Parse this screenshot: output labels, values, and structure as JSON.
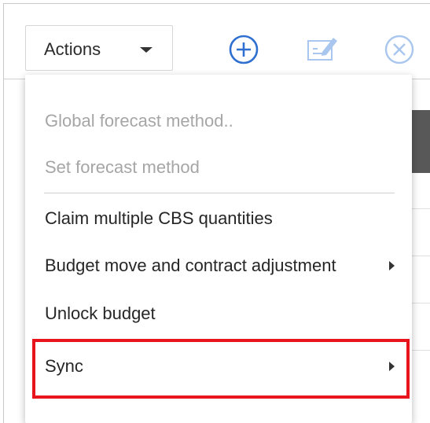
{
  "toolbar": {
    "actions_label": "Actions",
    "icons": [
      "add-circle-icon",
      "edit-icon",
      "close-circle-icon"
    ]
  },
  "menu": {
    "items": [
      {
        "label": "Global forecast method..",
        "disabled": true
      },
      {
        "label": "Set forecast method",
        "disabled": true
      },
      {
        "label": "Claim multiple CBS quantities",
        "disabled": false
      },
      {
        "label": "Budget move and contract adjustment",
        "disabled": false,
        "submenu": true
      },
      {
        "label": "Unlock budget",
        "disabled": false
      },
      {
        "label": "Sync",
        "disabled": false,
        "submenu": true,
        "highlighted": true
      }
    ]
  },
  "colors": {
    "accent_blue": "#2f6fd0",
    "highlight_red": "#e8141c",
    "disabled_text": "#a6a6a6"
  }
}
